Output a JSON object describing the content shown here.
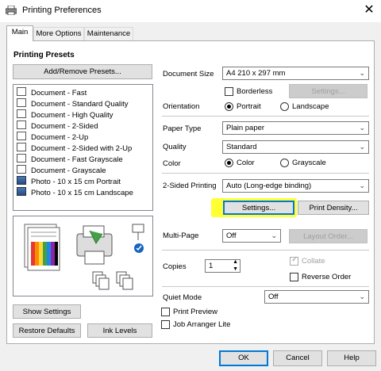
{
  "window": {
    "title": "Printing Preferences",
    "close_glyph": "✕"
  },
  "tabs": [
    {
      "label": "Main"
    },
    {
      "label": "More Options"
    },
    {
      "label": "Maintenance"
    }
  ],
  "presets": {
    "title": "Printing Presets",
    "add_remove_button": "Add/Remove Presets...",
    "items": [
      {
        "label": "Document - Fast"
      },
      {
        "label": "Document - Standard Quality"
      },
      {
        "label": "Document - High Quality"
      },
      {
        "label": "Document - 2-Sided"
      },
      {
        "label": "Document - 2-Up"
      },
      {
        "label": "Document - 2-Sided with 2-Up"
      },
      {
        "label": "Document - Fast Grayscale"
      },
      {
        "label": "Document - Grayscale"
      },
      {
        "label": "Photo - 10 x 15 cm Portrait"
      },
      {
        "label": "Photo - 10 x 15 cm Landscape"
      }
    ]
  },
  "left_buttons": {
    "show_settings": "Show Settings",
    "restore_defaults": "Restore Defaults",
    "ink_levels": "Ink Levels"
  },
  "settings": {
    "document_size": {
      "label": "Document Size",
      "value": "A4 210 x 297 mm"
    },
    "borderless": {
      "label": "Borderless",
      "checked": false
    },
    "borderless_settings_button": "Settings...",
    "orientation": {
      "label": "Orientation",
      "portrait": "Portrait",
      "landscape": "Landscape",
      "selected": "Portrait"
    },
    "paper_type": {
      "label": "Paper Type",
      "value": "Plain paper"
    },
    "quality": {
      "label": "Quality",
      "value": "Standard"
    },
    "color": {
      "label": "Color",
      "color": "Color",
      "grayscale": "Grayscale",
      "selected": "Color"
    },
    "two_sided": {
      "label": "2-Sided Printing",
      "value": "Auto (Long-edge binding)"
    },
    "two_sided_settings_button": "Settings...",
    "print_density_button": "Print Density...",
    "multi_page": {
      "label": "Multi-Page",
      "value": "Off"
    },
    "layout_order_button": "Layout Order...",
    "copies": {
      "label": "Copies",
      "value": "1"
    },
    "collate": {
      "label": "Collate",
      "checked": true
    },
    "reverse_order": {
      "label": "Reverse Order",
      "checked": false
    },
    "quiet_mode": {
      "label": "Quiet Mode",
      "value": "Off"
    },
    "print_preview": {
      "label": "Print Preview",
      "checked": false
    },
    "job_arranger": {
      "label": "Job Arranger Lite",
      "checked": false
    }
  },
  "footer": {
    "ok": "OK",
    "cancel": "Cancel",
    "help": "Help"
  },
  "colors": {
    "highlight": "#ffff33",
    "accent": "#0078d7"
  }
}
